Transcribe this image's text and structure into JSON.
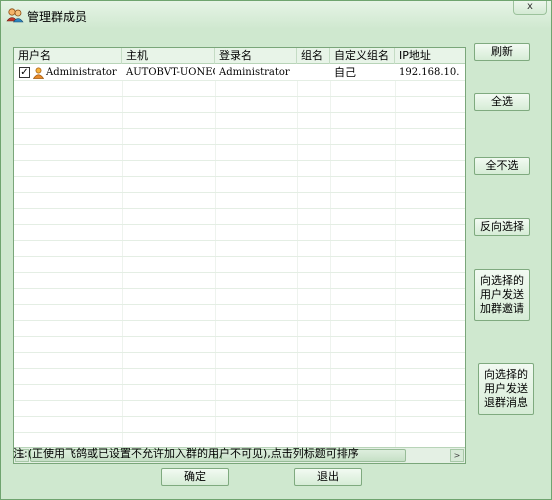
{
  "window": {
    "title": "管理群成员",
    "close_label": "x"
  },
  "table": {
    "columns": [
      "用户名",
      "主机",
      "登录名",
      "组名",
      "自定义组名",
      "IP地址"
    ],
    "rows": [
      {
        "checked": true,
        "username": "Administrator",
        "host": "AUTOBVT-UONECEQ",
        "login": "Administrator",
        "group": "",
        "custom_group": "自己",
        "ip": "192.168.10."
      }
    ],
    "scroll_left": "<",
    "scroll_right": ">"
  },
  "buttons": {
    "refresh": "刷新",
    "select_all": "全选",
    "select_none": "全不选",
    "invert": "反向选择",
    "invite": "向选择的\n用户发送\n加群邀请",
    "kick": "向选择的\n用户发送\n退群消息",
    "ok": "确定",
    "exit": "退出"
  },
  "note": "注:(正使用飞鸽或已设置不允许加入群的用户不可见),点击列标题可排序",
  "colors": {
    "window_bg": "#cfe8cf",
    "border": "#7aa67a"
  }
}
